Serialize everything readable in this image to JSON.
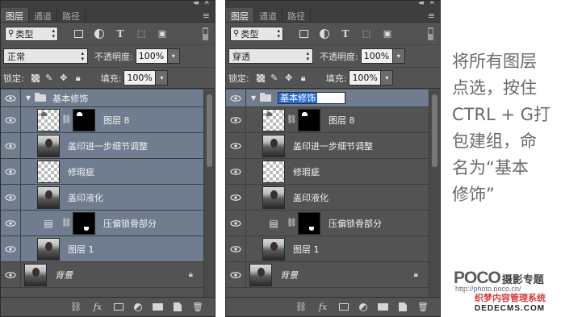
{
  "panels": [
    {
      "tabs": [
        "图层",
        "通道",
        "路径"
      ],
      "kind_select": "类型",
      "blend_mode": "正常",
      "opacity_label": "不透明度:",
      "opacity_value": "100%",
      "lock_label": "锁定:",
      "fill_label": "填充:",
      "fill_value": "100%",
      "group_name": "基本修饰",
      "layers": [
        {
          "name": "图层 8",
          "type": "mask-layer"
        },
        {
          "name": "盖印进一步细节调整",
          "type": "photo"
        },
        {
          "name": "修瑕疵",
          "type": "transparent"
        },
        {
          "name": "盖印液化",
          "type": "photo"
        },
        {
          "name": "压偏锁骨部分",
          "type": "adjustment"
        },
        {
          "name": "图层 1",
          "type": "photo"
        }
      ],
      "background_layer": "背景"
    },
    {
      "tabs": [
        "图层",
        "通道",
        "路径"
      ],
      "kind_select": "类型",
      "blend_mode": "穿透",
      "opacity_label": "不透明度:",
      "opacity_value": "100%",
      "lock_label": "锁定:",
      "fill_label": "填充:",
      "fill_value": "100%",
      "group_name": "基本修饰",
      "layers": [
        {
          "name": "图层 8",
          "type": "mask-layer"
        },
        {
          "name": "盖印进一步细节调整",
          "type": "photo"
        },
        {
          "name": "修瑕疵",
          "type": "transparent"
        },
        {
          "name": "盖印液化",
          "type": "photo"
        },
        {
          "name": "压偏锁骨部分",
          "type": "adjustment"
        },
        {
          "name": "图层 1",
          "type": "photo"
        }
      ],
      "background_layer": "背景"
    }
  ],
  "caption": {
    "lines": [
      "将所有图层",
      "点选，按住",
      "CTRL + G打",
      "包建组，命",
      "名为“基本",
      "修饰”"
    ]
  },
  "logo": {
    "brand": "POCO",
    "label": "摄影专题",
    "url": "http://photo.poco.cn/"
  },
  "watermark": {
    "line1": "织梦内容管理系统",
    "line2": "DEDECMS.COM"
  },
  "colors": {
    "panel_bg": "#535353",
    "selected_row": "#6f7d8f",
    "rename_highlight": "#2a6cd6"
  }
}
